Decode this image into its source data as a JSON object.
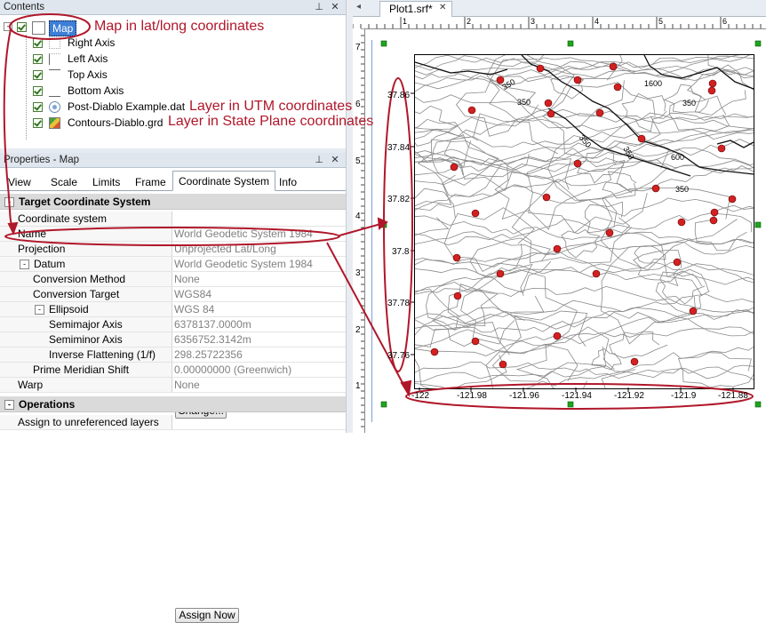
{
  "contents_panel": {
    "title": "Contents",
    "pin_glyph": "📌",
    "close_glyph": "✕",
    "items": [
      {
        "label": "Map",
        "selected": true
      },
      {
        "label": "Right Axis"
      },
      {
        "label": "Left Axis"
      },
      {
        "label": "Top Axis"
      },
      {
        "label": "Bottom Axis"
      },
      {
        "label": "Post-Diablo Example.dat"
      },
      {
        "label": "Contours-Diablo.grd"
      }
    ]
  },
  "properties_panel": {
    "title": "Properties - Map",
    "tabs": [
      "View",
      "Scale",
      "Limits",
      "Frame",
      "Coordinate System",
      "Info"
    ],
    "active_tab": "Coordinate System",
    "section_target": "Target Coordinate System",
    "rows": {
      "coordinate_system": {
        "label": "Coordinate system",
        "button": "Change..."
      },
      "name": {
        "label": "Name",
        "value": "World Geodetic System 1984"
      },
      "projection": {
        "label": "Projection",
        "value": "Unprojected Lat/Long"
      },
      "datum": {
        "label": "Datum",
        "value": "World Geodetic System 1984"
      },
      "conversion_method": {
        "label": "Conversion Method",
        "value": "None"
      },
      "conversion_target": {
        "label": "Conversion Target",
        "value": "WGS84"
      },
      "ellipsoid": {
        "label": "Ellipsoid",
        "value": "WGS 84"
      },
      "semimajor": {
        "label": "Semimajor Axis",
        "value": "6378137.0000m"
      },
      "semiminor": {
        "label": "Semiminor Axis",
        "value": "6356752.3142m"
      },
      "inverse_flattening": {
        "label": "Inverse Flattening (1/f)",
        "value": "298.25722356"
      },
      "prime_meridian": {
        "label": "Prime Meridian Shift",
        "value": "0.00000000 (Greenwich)"
      },
      "warp": {
        "label": "Warp",
        "value": "None"
      }
    },
    "section_operations": "Operations",
    "assign_row": {
      "label": "Assign to unreferenced layers",
      "button": "Assign Now"
    }
  },
  "document": {
    "tab_label": "Plot1.srf*",
    "tab_close": "✕",
    "nav_glyph": "◂",
    "ruler_left_labels": [
      "7",
      "6",
      "5",
      "4",
      "3",
      "2",
      "1"
    ],
    "ruler_top_labels": [
      "1",
      "2",
      "3",
      "4",
      "5",
      "6"
    ],
    "y_ticks": [
      "37.86",
      "37.84",
      "37.82",
      "37.8",
      "37.78",
      "37.76"
    ],
    "x_ticks": [
      "-122",
      "-121.98",
      "-121.96",
      "-121.94",
      "-121.92",
      "-121.9",
      "-121.88"
    ],
    "contour_labels": [
      "350",
      "1600",
      "350",
      "350",
      "600",
      "350",
      "350",
      "350"
    ]
  },
  "annotations": {
    "map": "Map in lat/long coordinates",
    "utm": "Layer in UTM coordinates",
    "state_plane": "Layer in State Plane coordinates"
  },
  "colors": {
    "annotation": "#b0172a",
    "post_marker": "#d42020",
    "selection_blue": "#3d7fd6"
  }
}
